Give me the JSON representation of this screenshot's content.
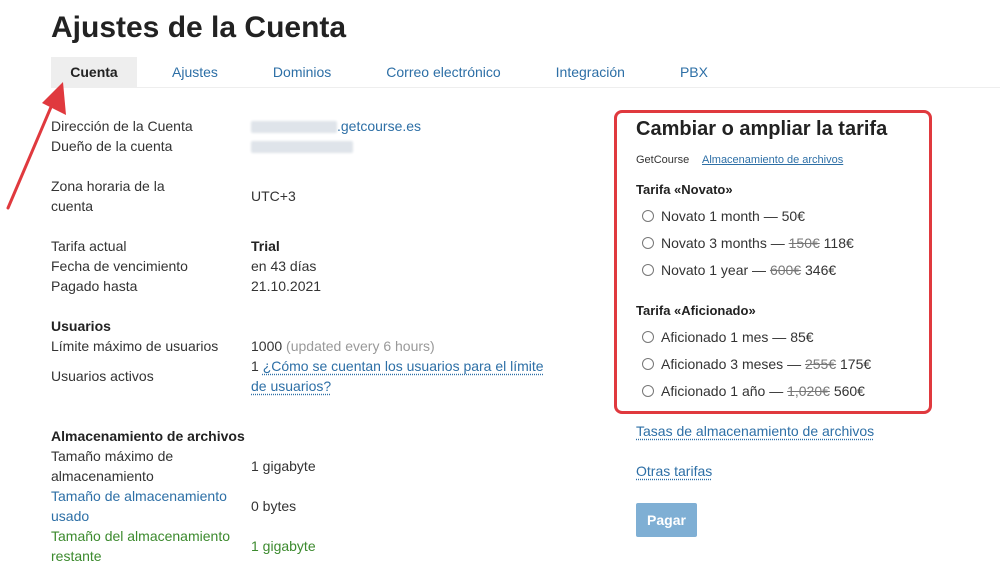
{
  "page": {
    "title": "Ajustes de la Cuenta"
  },
  "tabs": [
    {
      "label": "Cuenta",
      "active": true
    },
    {
      "label": "Ajustes"
    },
    {
      "label": "Dominios"
    },
    {
      "label": "Correo electrónico"
    },
    {
      "label": "Integración"
    },
    {
      "label": "PBX"
    }
  ],
  "account": {
    "address_label": "Dirección de la Cuenta",
    "address_value": ".getcourse.es",
    "owner_label": "Dueño de la cuenta",
    "timezone_label": "Zona horaria de la cuenta",
    "timezone_value": "UTC+3",
    "plan_label": "Tarifa actual",
    "plan_value": "Trial",
    "expiry_label": "Fecha de vencimiento",
    "expiry_value": "en 43 días",
    "paid_label": "Pagado hasta",
    "paid_value": "21.10.2021"
  },
  "users": {
    "section_title": "Usuarios",
    "limit_label": "Límite máximo de usuarios",
    "limit_value": "1000",
    "limit_note": "(updated every 6 hours)",
    "active_label": "Usuarios activos",
    "active_value": "1",
    "active_link": "¿Cómo se cuentan los usuarios para el límite de usuarios?"
  },
  "storage": {
    "section_title": "Almacenamiento de archivos",
    "max_label": "Tamaño máximo de almacenamiento",
    "max_value": "1 gigabyte",
    "used_label": "Tamaño de almacenamiento usado",
    "used_value": "0 bytes",
    "remaining_label": "Tamaño del almacenamiento restante",
    "remaining_value": "1 gigabyte"
  },
  "upgrade": {
    "title": "Cambiar o ampliar la tarifa",
    "sub_getcourse": "GetCourse",
    "sub_storage": "Almacenamiento de archivos",
    "groups": [
      {
        "title": "Tarifa «Novato»",
        "options": [
          {
            "label": "Novato 1 month — ",
            "old": "",
            "price": "50€"
          },
          {
            "label": "Novato 3 months — ",
            "old": "150€",
            "price": "118€"
          },
          {
            "label": "Novato 1 year — ",
            "old": "600€",
            "price": "346€"
          }
        ]
      },
      {
        "title": "Tarifa «Aficionado»",
        "options": [
          {
            "label": "Aficionado 1 mes — ",
            "old": "",
            "price": "85€"
          },
          {
            "label": "Aficionado 3 meses — ",
            "old": "255€",
            "price": "175€"
          },
          {
            "label": "Aficionado 1 año — ",
            "old": "1,020€",
            "price": "560€"
          }
        ]
      }
    ],
    "storage_rates_link": "Tasas de almacenamiento de archivos",
    "other_plans_link": "Otras tarifas",
    "pay_button": "Pagar"
  },
  "colors": {
    "accent_red": "#e0393e",
    "link": "#2d6fa6",
    "green": "#3c8a2e",
    "button": "#7fafd4"
  }
}
